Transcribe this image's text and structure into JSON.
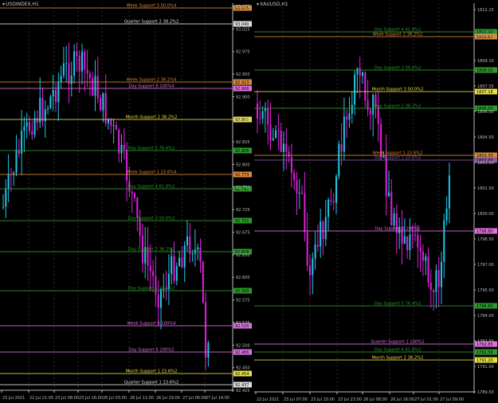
{
  "panels": [
    {
      "id": "usd",
      "title": "USDINDEX,H1",
      "x_labels": [
        "22 Jul 2021",
        "22 Jul 21:00",
        "23 Jul 08:00",
        "23 Jul 16:00",
        "26 Jul 03:00",
        "26 Jul 11:00",
        "26 Jul 19:00",
        "27 Jul 06:00",
        "27 Jul 14:00"
      ],
      "y_ticks": [
        "93.075",
        "93.025",
        "92.975",
        "92.950",
        "92.900",
        "92.875",
        "92.825",
        "92.800",
        "92.750",
        "92.725",
        "92.675",
        "92.650",
        "92.600",
        "92.575",
        "92.525",
        "92.500",
        "92.450",
        "92.425"
      ],
      "levels": [
        {
          "label": "Week Support 3 50.0%4",
          "color": "#d98a3a",
          "price": "93.075"
        },
        {
          "label": "Quarter Support 2 38.2%2",
          "color": "#e0e0e0",
          "price": "93.040"
        },
        {
          "label": "Week Support 2 38.2%4",
          "color": "#d98a3a",
          "price": "92.923"
        },
        {
          "label": "Day Support 6 100%4",
          "color": "#e070e0",
          "price": "92.906"
        },
        {
          "label": "Month Support 2 38.2%2",
          "color": "#e8e040",
          "price": "92.861"
        },
        {
          "label": "Day Support 5 76.4%2",
          "color": "#2e9a2e",
          "price": "92.806"
        },
        {
          "label": "Week Support 1 23.6%4",
          "color": "#d98a3a",
          "price": "92.773"
        },
        {
          "label": "Day Support 4 61.8%2",
          "color": "#2e9a2e",
          "price": "92.747"
        },
        {
          "label": "Day Support 3 50.0%2",
          "color": "#2e9a2e",
          "price": "92.701"
        },
        {
          "label": "Day Support 2 38.2%2",
          "color": "#2e9a2e",
          "price": "92.656"
        },
        {
          "label": "Day Support 1 23.6%2",
          "color": "#2e9a2e",
          "price": "92.569"
        },
        {
          "label": "Week Support 6 100%4",
          "color": "#e070e0",
          "price": "92.520"
        },
        {
          "label": "Day Support 6 100%2",
          "color": "#e070e0",
          "price": "92.486"
        },
        {
          "label": "Month Support 1 23.6%2",
          "color": "#e8e040",
          "price": "92.454"
        },
        {
          "label": "Quarter Support 1 23.6%2",
          "color": "#e0e0e0",
          "price": "92.437"
        }
      ]
    },
    {
      "id": "xau",
      "title": "XAUUSD,H1",
      "x_labels": [
        "22 Jul 2021",
        "23 Jul 07:00",
        "23 Jul 15:00",
        "23 Jul 23:00",
        "26 Jul 08:00",
        "26 Jul 16:00",
        "27 Jul 01:00",
        "27 Jul 09:00"
      ],
      "y_ticks": [
        "1812.15",
        "1810.60",
        "1809.10",
        "1807.55",
        "1806.00",
        "1804.50",
        "1803.00",
        "1801.50",
        "1800.00",
        "1798.50",
        "1797.00",
        "1795.50",
        "1794.00",
        "1792.50",
        "1791.00",
        "1789.50"
      ],
      "levels": [
        {
          "label": "Day Support 4 61.8%2",
          "color": "#2e9a2e",
          "price": "1811.10"
        },
        {
          "label": "Week Support 2 38.2%2",
          "color": "#d98a3a",
          "price": "1810.67"
        },
        {
          "label": "Day Support 3 50.0%2",
          "color": "#2e9a2e",
          "price": "1808.00"
        },
        {
          "label": "Month Support 3 50.0%2",
          "color": "#e8e040",
          "price": "1807.18"
        },
        {
          "label": "Day Support 2 38.2%2",
          "color": "#2e9a2e",
          "price": "1806.00"
        },
        {
          "label": "Week Support 1 23.6%2",
          "color": "#d98a3a",
          "price": "1803.30"
        },
        {
          "label": "Day Support 1 23.6%2",
          "color": "#8a5aa0",
          "price": "1802.00"
        },
        {
          "label": "Day Support 6 100%2",
          "color": "#e070e0",
          "price": "1798.80"
        },
        {
          "label": "Day Support 5 76.4%2",
          "color": "#2e9a2e",
          "price": "1794.80"
        },
        {
          "label": "Quarter Support 1 100%2",
          "color": "#e070e0",
          "price": "1792.85"
        },
        {
          "label": "Day Support 4 61.8%2",
          "color": "#2e9a2e",
          "price": "1792.50"
        },
        {
          "label": "Month Support 2 38.2%2",
          "color": "#e8e040",
          "price": "1791.20"
        }
      ]
    }
  ],
  "colors": {
    "bull": "#1ec8e8",
    "bear": "#e020e0",
    "grid": "#2a2a2a",
    "axis": "#bcbcbc"
  }
}
